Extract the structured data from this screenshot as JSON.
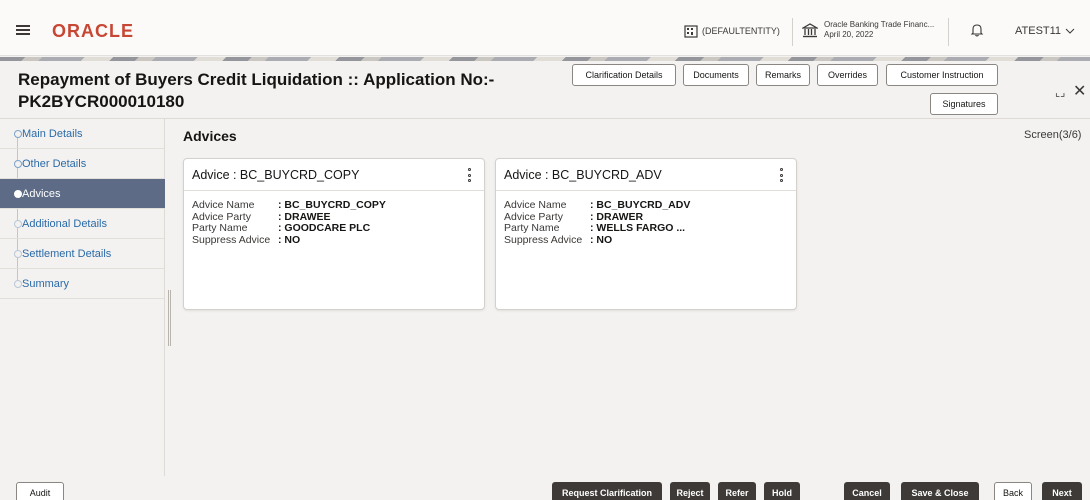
{
  "header": {
    "logo": "ORACLE",
    "entity": "(DEFAULTENTITY)",
    "branch_name": "Oracle Banking Trade Financ...",
    "branch_date": "April 20, 2022",
    "user": "ATEST11"
  },
  "title": {
    "line1": "Repayment of Buyers Credit Liquidation :: Application No:-",
    "line2": "PK2BYCR000010180"
  },
  "header_buttons": {
    "clarification": "Clarification Details",
    "documents": "Documents",
    "remarks": "Remarks",
    "overrides": "Overrides",
    "customer_instruction": "Customer Instruction",
    "signatures": "Signatures"
  },
  "sidebar": {
    "items": [
      {
        "label": "Main Details"
      },
      {
        "label": "Other Details"
      },
      {
        "label": "Advices"
      },
      {
        "label": "Additional Details"
      },
      {
        "label": "Settlement Details"
      },
      {
        "label": "Summary"
      }
    ]
  },
  "main": {
    "section_title": "Advices",
    "screen": "Screen(3/6)",
    "cards": [
      {
        "title": "Advice : BC_BUYCRD_COPY",
        "fields": [
          {
            "label": "Advice Name",
            "value": ": BC_BUYCRD_COPY"
          },
          {
            "label": "Advice Party",
            "value": ": DRAWEE"
          },
          {
            "label": "Party Name",
            "value": ": GOODCARE PLC"
          },
          {
            "label": "Suppress Advice",
            "value": ": NO"
          }
        ]
      },
      {
        "title": "Advice : BC_BUYCRD_ADV",
        "fields": [
          {
            "label": "Advice Name",
            "value": ": BC_BUYCRD_ADV"
          },
          {
            "label": "Advice Party",
            "value": ": DRAWER"
          },
          {
            "label": "Party Name",
            "value": ": WELLS FARGO ..."
          },
          {
            "label": "Suppress Advice",
            "value": ": NO"
          }
        ]
      }
    ]
  },
  "footer": {
    "audit": "Audit",
    "request_clarification": "Request Clarification",
    "reject": "Reject",
    "refer": "Refer",
    "hold": "Hold",
    "cancel": "Cancel",
    "save_close": "Save & Close",
    "back": "Back",
    "next": "Next"
  },
  "colors": {
    "brand": "#c74634",
    "active_nav": "#5d6b86",
    "link": "#2b6aa8",
    "dark_button": "#3d3a37"
  }
}
